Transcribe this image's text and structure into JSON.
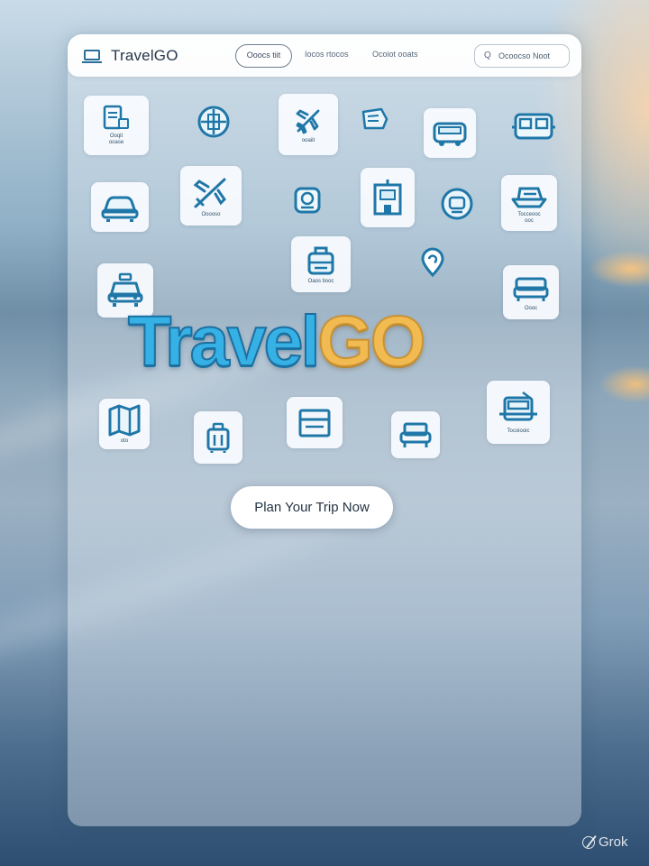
{
  "header": {
    "brand": "TravelGO",
    "nav": [
      "Ooocs tiit",
      "Iocos rtocos",
      "Ocoiot ooats"
    ],
    "search_icon": "Q",
    "search_placeholder": "Ocoocso Noot"
  },
  "tiles": [
    {
      "icon": "itinerary-icon",
      "caption": "Ooqit\nooase"
    },
    {
      "icon": "globe-icon",
      "caption": ""
    },
    {
      "icon": "airplane-icon",
      "caption": "ooaiit"
    },
    {
      "icon": "ticket-icon",
      "caption": ""
    },
    {
      "icon": "bus-icon",
      "caption": ""
    },
    {
      "icon": "train-icon",
      "caption": ""
    },
    {
      "icon": "car-icon",
      "caption": ""
    },
    {
      "icon": "plane-departure-icon",
      "caption": "Ooooso"
    },
    {
      "icon": "passport-icon",
      "caption": ""
    },
    {
      "icon": "hotel-building-icon",
      "caption": ""
    },
    {
      "icon": "compass-icon",
      "caption": ""
    },
    {
      "icon": "cruise-icon",
      "caption": "Tocceooc\nooc"
    },
    {
      "icon": "taxi-icon",
      "caption": ""
    },
    {
      "icon": "luggage-icon",
      "caption": "Oaos tiooc"
    },
    {
      "icon": "location-pin-icon",
      "caption": ""
    },
    {
      "icon": "bed-icon",
      "caption": "Oooc"
    },
    {
      "icon": "map-icon",
      "caption": "oto"
    },
    {
      "icon": "suitcase-icon",
      "caption": ""
    },
    {
      "icon": "calendar-icon",
      "caption": ""
    },
    {
      "icon": "sofa-icon",
      "caption": ""
    },
    {
      "icon": "tram-icon",
      "caption": "Tocoiooic"
    }
  ],
  "hero": {
    "part1": "Travel",
    "part2": "GO"
  },
  "cta": {
    "label": "Plan Your Trip Now"
  },
  "watermark": {
    "text": "Grok"
  },
  "colors": {
    "icon": "#1f77a8",
    "logo_blue": "#35b1e6",
    "logo_gold": "#f2bb52"
  }
}
